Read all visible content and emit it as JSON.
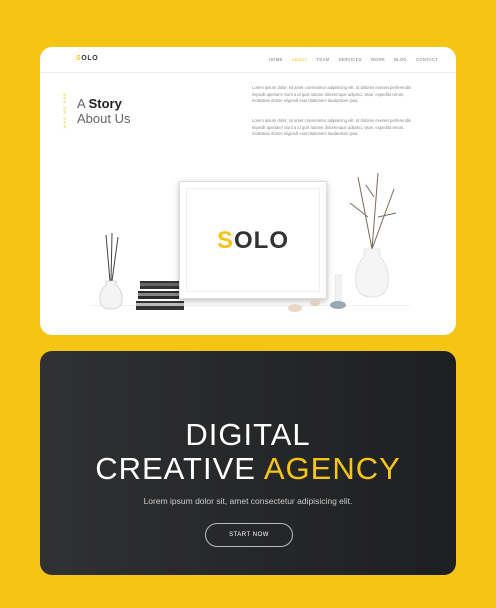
{
  "top": {
    "logo": "SOLO",
    "logo_first": "S",
    "logo_rest": "OLO",
    "menu": [
      "HOME",
      "ABOUT",
      "TEAM",
      "SERVICES",
      "WORK",
      "BLOG",
      "CONTACT"
    ],
    "active_menu": "ABOUT",
    "vertical_text": "WHO WE ARE",
    "heading_prefix": "A",
    "heading_strong": "Story",
    "heading_line2": "About Us",
    "paragraph1": "Lorem ipsum dolor, sit amet consectetur adipisicing elit. Id dolores eveniet perferendis impedit aperiam! Sunt a id quis ratione doloremque adipisci, vitae, expedita rerum, molestiae dolore eligendi exercitationem laudantium ipsa.",
    "paragraph2": "Lorem ipsum dolor, sit amet consectetur adipisicing elit. Id dolores eveniet perferendis impedit aperiam! Sunt a id quis ratione doloremque adipisci, vitae, expedita rerum, molestiae dolore eligendi exercitationem laudantium ipsa.",
    "frame_logo_first": "S",
    "frame_logo_rest": "OLO"
  },
  "hero": {
    "line1": "DIGITAL",
    "line2_plain": "CREATIVE",
    "line2_accent": "AGENCY",
    "subtitle": "Lorem ipsum dolor sit, amet consectetur adipisicing elit.",
    "button": "START NOW"
  },
  "colors": {
    "accent": "#F6C415",
    "hero_bg": "#2a2b2d"
  }
}
